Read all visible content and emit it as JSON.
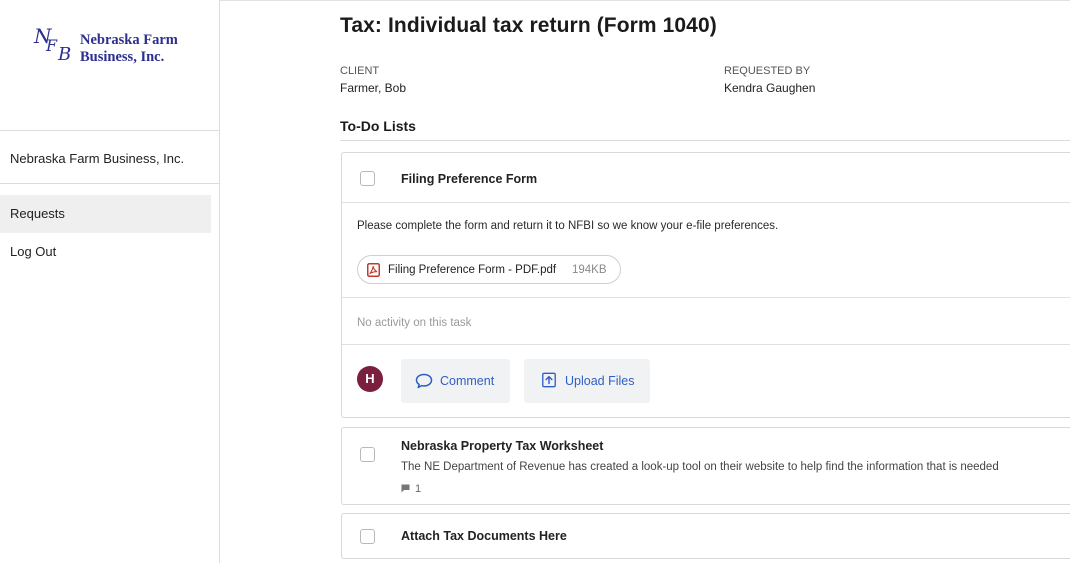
{
  "sidebar": {
    "logo": {
      "monogram": [
        "N",
        "F",
        "B"
      ],
      "line1": "Nebraska Farm",
      "line2": "Business, Inc."
    },
    "org_name": "Nebraska Farm Business, Inc.",
    "items": [
      {
        "label": "Requests",
        "active": true
      },
      {
        "label": "Log Out",
        "active": false
      }
    ]
  },
  "header": {
    "title": "Tax: Individual tax return (Form 1040)",
    "client_label": "CLIENT",
    "client_value": "Farmer, Bob",
    "requested_by_label": "REQUESTED BY",
    "requested_by_value": "Kendra Gaughen"
  },
  "todo": {
    "section_title": "To-Do Lists",
    "tasks": [
      {
        "title": "Filing Preference Form",
        "expanded": true,
        "description": "Please complete the form and return it to NFBI so we know your e-file preferences.",
        "attachment": {
          "name": "Filing Preference Form - PDF.pdf",
          "size": "194KB",
          "icon": "pdf-file-icon"
        },
        "activity_text": "No activity on this task",
        "avatar_initial": "H",
        "comment_label": "Comment",
        "upload_label": "Upload Files"
      },
      {
        "title": "Nebraska Property Tax Worksheet",
        "expanded": false,
        "subtitle": "The NE Department of Revenue has created a look-up tool on their website to help find the information that is needed",
        "comment_count": "1"
      },
      {
        "title": "Attach Tax Documents Here",
        "expanded": false
      }
    ]
  },
  "colors": {
    "brand": "#2b2f8f",
    "accent_link": "#2f5fc4",
    "avatar_bg": "#7a1f3d",
    "pdf_icon": "#c0392b",
    "button_bg": "#f1f2f4"
  }
}
